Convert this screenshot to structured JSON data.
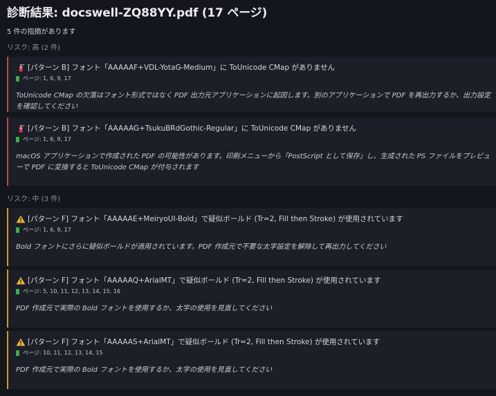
{
  "header": {
    "title": "診断結果: docswell-ZQ88YY.pdf (17 ページ)",
    "summary": "5 件の指摘があります"
  },
  "sections": [
    {
      "label": "リスク: 高 (2 件)",
      "severity_color": "#b84a55",
      "items": [
        {
          "icon": "fire-extinguisher-icon",
          "title": "[パターン B] フォント「AAAAAF+VDL-YotaG-Medium」に ToUnicode CMap がありません",
          "pages": "ページ: 1, 6, 9, 17",
          "advice": "ToUnicode CMap の欠落はフォント形式ではなく PDF 出力元アプリケーションに起因します。別のアプリケーションで PDF を再出力するか、出力設定を確認してください"
        },
        {
          "icon": "fire-extinguisher-icon",
          "title": "[パターン B] フォント「AAAAAG+TsukuBRdGothic-Regular」に ToUnicode CMap がありません",
          "pages": "ページ: 1, 6, 9, 17",
          "advice": "macOS アプリケーションで作成された PDF の可能性があります。印刷メニューから「PostScript として保存」し、生成された PS ファイルをプレビューで PDF に変換すると ToUnicode CMap が付与されます"
        }
      ]
    },
    {
      "label": "リスク: 中 (3 件)",
      "severity_color": "#d49a2a",
      "items": [
        {
          "icon": "warning-icon",
          "title": "[パターン F] フォント「AAAAAE+MeiryoUI-Bold」で疑似ボールド (Tr=2, Fill then Stroke) が使用されています",
          "pages": "ページ: 1, 6, 9, 17",
          "advice": "Bold フォントにさらに疑似ボールドが適用されています。PDF 作成元で不要な太字設定を解除して再出力してください"
        },
        {
          "icon": "warning-icon",
          "title": "[パターン F] フォント「AAAAAQ+ArialMT」で疑似ボールド (Tr=2, Fill then Stroke) が使用されています",
          "pages": "ページ: 5, 10, 11, 12, 13, 14, 15, 16",
          "advice": "PDF 作成元で実際の Bold フォントを使用するか、太字の使用を見直してください"
        },
        {
          "icon": "warning-icon",
          "title": "[パターン F] フォント「AAAAAS+ArialMT」で疑似ボールド (Tr=2, Fill then Stroke) が使用されています",
          "pages": "ページ: 10, 11, 12, 13, 14, 15",
          "advice": "PDF 作成元で実際の Bold フォントを使用するか、太字の使用を見直してください"
        }
      ]
    }
  ]
}
